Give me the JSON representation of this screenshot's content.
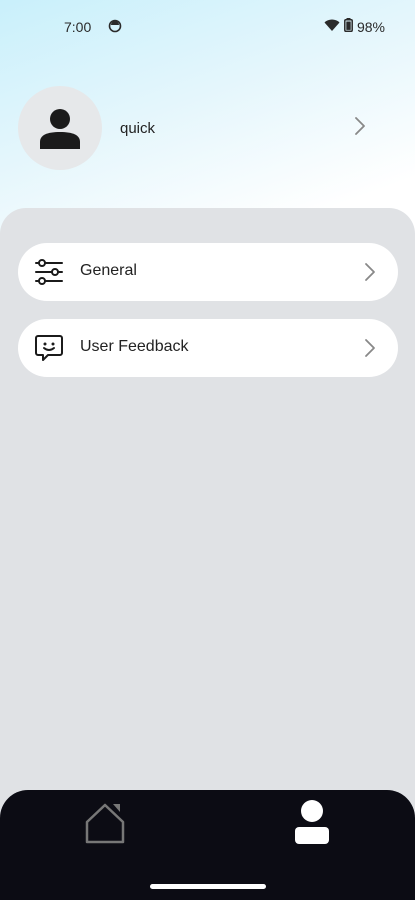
{
  "status_bar": {
    "time": "7:00",
    "battery_percent": "98%"
  },
  "profile": {
    "username": "quick"
  },
  "menu": {
    "items": [
      {
        "label": "General",
        "icon": "sliders-icon"
      },
      {
        "label": "User Feedback",
        "icon": "feedback-chat-icon"
      }
    ]
  },
  "bottom_nav": {
    "items": [
      {
        "icon": "home-icon",
        "active": false
      },
      {
        "icon": "user-icon",
        "active": true
      }
    ]
  },
  "colors": {
    "panel_bg": "#e0e2e5",
    "nav_bg": "#0c0c14",
    "card_bg": "#ffffff"
  }
}
